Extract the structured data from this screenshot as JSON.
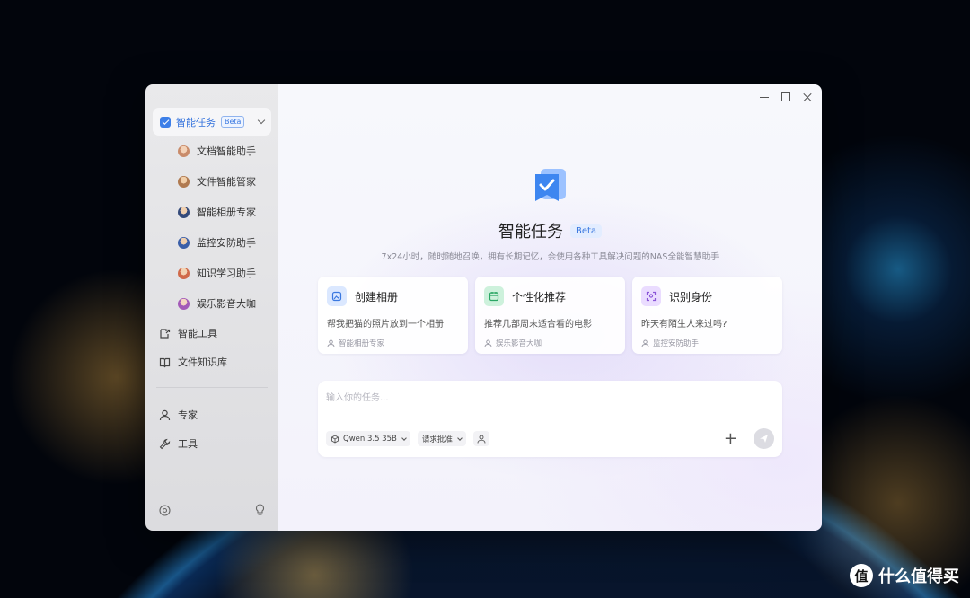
{
  "window": {
    "controls": {
      "minimize": "minimize",
      "maximize": "maximize",
      "close": "close"
    }
  },
  "sidebar": {
    "group": {
      "label": "智能任务",
      "badge": "Beta",
      "icon": "task-check-icon",
      "color": "#2f6fdc"
    },
    "sub_items": [
      {
        "label": "文档智能助手"
      },
      {
        "label": "文件智能管家"
      },
      {
        "label": "智能相册专家"
      },
      {
        "label": "监控安防助手"
      },
      {
        "label": "知识学习助手"
      },
      {
        "label": "娱乐影音大咖"
      }
    ],
    "nav": [
      {
        "label": "智能工具",
        "icon": "tool-share-icon"
      },
      {
        "label": "文件知识库",
        "icon": "book-icon"
      }
    ],
    "nav2": [
      {
        "label": "专家",
        "icon": "person-icon"
      },
      {
        "label": "工具",
        "icon": "wrench-icon"
      }
    ],
    "bottom": {
      "left_icon": "settings-icon",
      "right_icon": "lightbulb-icon"
    }
  },
  "main": {
    "hero": {
      "title": "智能任务",
      "badge": "Beta",
      "subtitle": "7x24小时，随时随地召唤，拥有长期记忆，会使用各种工具解决问题的NAS全能智慧助手"
    },
    "cards": [
      {
        "title": "创建相册",
        "desc": "帮我把猫的照片放到一个相册",
        "meta": "智能相册专家",
        "icon": "album-icon",
        "color": "#dbe8ff"
      },
      {
        "title": "个性化推荐",
        "desc": "推荐几部周末适合看的电影",
        "meta": "娱乐影音大咖",
        "icon": "calendar-icon",
        "color": "#cdf1dc"
      },
      {
        "title": "识别身份",
        "desc": "昨天有陌生人来过吗?",
        "meta": "监控安防助手",
        "icon": "face-scan-icon",
        "color": "#eadcff"
      }
    ],
    "input": {
      "placeholder": "输入你的任务...",
      "model": "Qwen 3.5 35B",
      "approval": "请求批准"
    }
  },
  "watermark": {
    "text": "什么值得买",
    "logo": "值"
  }
}
